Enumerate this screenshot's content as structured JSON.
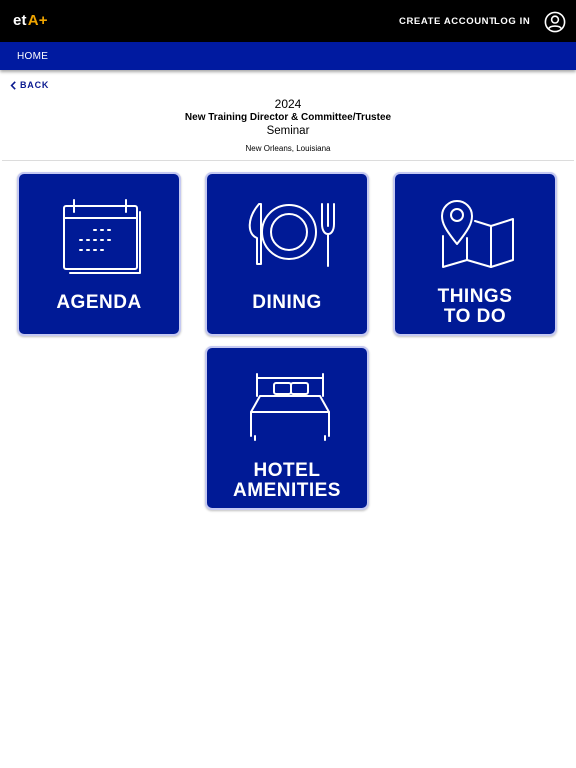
{
  "header": {
    "logo_main": "et",
    "logo_accent": "A+",
    "create_account": "CREATE ACCOUNT",
    "login": "LOG IN",
    "profile_icon": "user-circle-icon"
  },
  "nav": {
    "home": "HOME"
  },
  "back": {
    "label": "BACK",
    "icon": "chevron-left-icon"
  },
  "event": {
    "year": "2024",
    "title": "New Training Director & Committee/Trustee",
    "subtitle": "Seminar",
    "location": "New Orleans, Louisiana"
  },
  "tiles": [
    {
      "label": "AGENDA",
      "icon": "calendar-icon"
    },
    {
      "label": "DINING",
      "icon": "plate-utensils-icon"
    },
    {
      "label": "THINGS\nTO DO",
      "icon": "map-pin-icon"
    },
    {
      "label": "HOTEL\nAMENITIES",
      "icon": "bed-icon"
    }
  ],
  "colors": {
    "topbar": "#000000",
    "navbar": "#001aa0",
    "tile_bg": "#001a96",
    "tile_border": "#c5c9f2",
    "logo_accent": "#f0a500",
    "back_link": "#0a1a90"
  }
}
